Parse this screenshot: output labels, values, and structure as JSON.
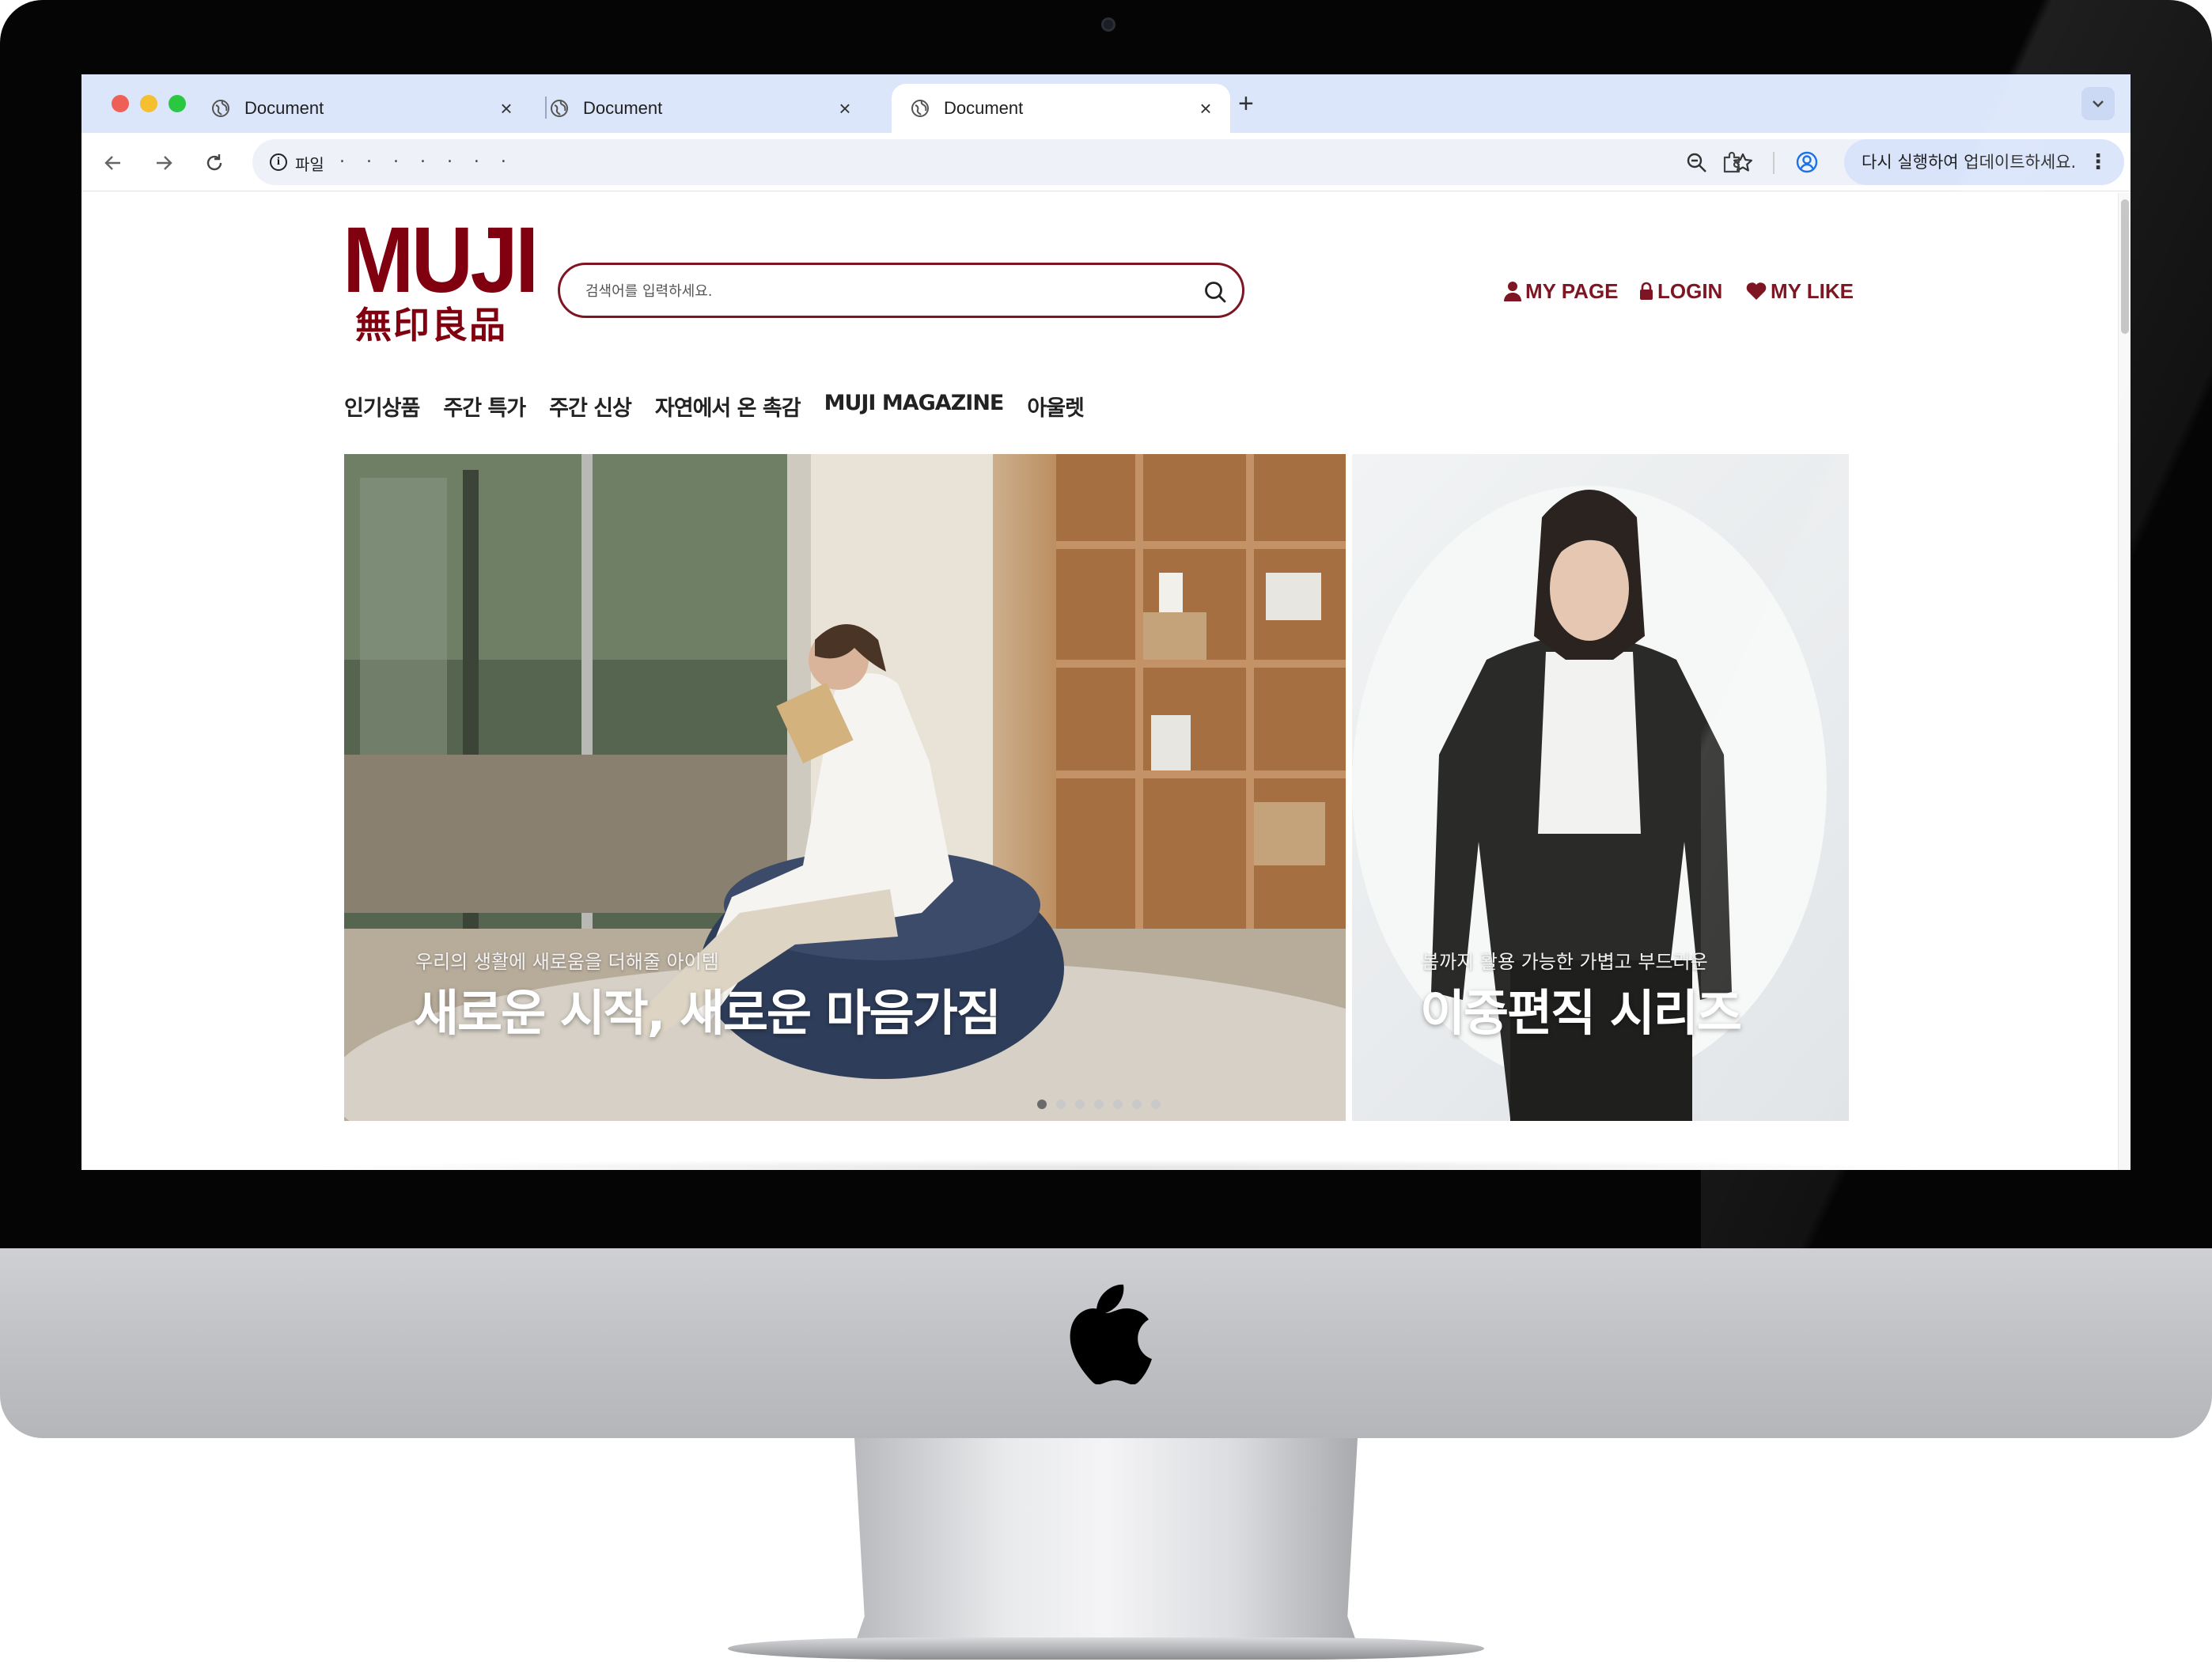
{
  "browser": {
    "tabs": [
      {
        "title": "Document",
        "close": "×"
      },
      {
        "title": "Document",
        "close": "×"
      },
      {
        "title": "Document",
        "close": "×",
        "active": true
      }
    ],
    "new_tab": "+",
    "address": {
      "scheme_label": "파일",
      "url_masked": ". . . . . . ."
    },
    "update_button": "다시 실행하여 업데이트하세요.",
    "menu": "⋮",
    "accent": "#dbe6fb"
  },
  "site": {
    "logo": {
      "en": "MUJI",
      "kr": "無印良品",
      "color": "#800010"
    },
    "search": {
      "placeholder": "검색어를 입력하세요."
    },
    "util_links": [
      {
        "label": "MY PAGE",
        "icon": "person-icon"
      },
      {
        "label": "LOGIN",
        "icon": "lock-icon"
      },
      {
        "label": "MY LIKE",
        "icon": "heart-icon"
      }
    ],
    "nav": [
      "인기상품",
      "주간 특가",
      "주간 신상",
      "자연에서 온 촉감",
      "MUJI MAGAZINE",
      "아울렛"
    ],
    "banners": [
      {
        "subtitle": "우리의 생활에 새로움을 더해줄 아이템",
        "title": "새로운 시작, 새로운 마음가짐"
      },
      {
        "subtitle": "봄까지 활용 가능한 가볍고 부드러운",
        "title": "이중편직 시리즈"
      }
    ],
    "carousel": {
      "count": 7,
      "active_index": 0
    },
    "brand_color": "#7d1622"
  }
}
